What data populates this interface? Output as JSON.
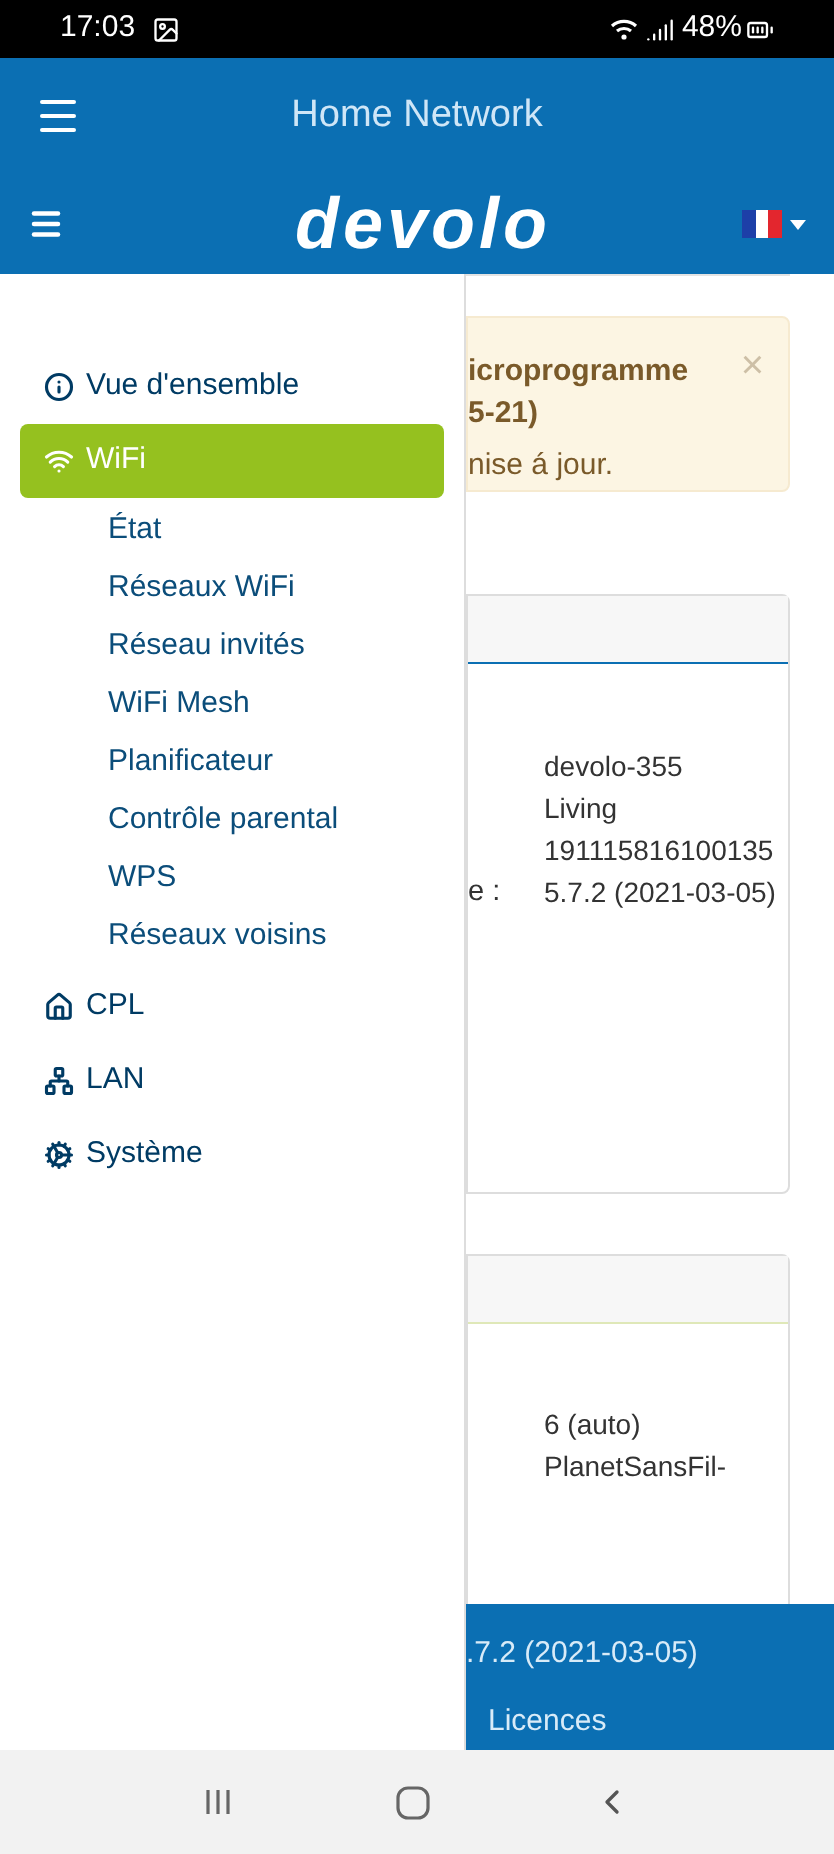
{
  "status_bar": {
    "time": "17:03",
    "battery": "48%"
  },
  "app_bar": {
    "title": "Home Network"
  },
  "header": {
    "logo": "devolo"
  },
  "drawer": {
    "items": [
      {
        "label": "Vue d'ensemble",
        "selected": false
      },
      {
        "label": "WiFi",
        "selected": true,
        "children": [
          {
            "label": "État",
            "selected": false
          },
          {
            "label": "Réseaux WiFi",
            "selected": false
          },
          {
            "label": "Réseau invités",
            "selected": false
          },
          {
            "label": "WiFi Mesh",
            "selected": false
          },
          {
            "label": "Planificateur",
            "selected": false
          },
          {
            "label": "Contrôle parental",
            "selected": false
          },
          {
            "label": "WPS",
            "selected": false
          },
          {
            "label": "Réseaux voisins",
            "selected": false
          }
        ]
      },
      {
        "label": "CPL",
        "selected": false
      },
      {
        "label": "LAN",
        "selected": false
      },
      {
        "label": "Système",
        "selected": false
      }
    ]
  },
  "content": {
    "alert": {
      "title_lines": [
        "icroprogramme",
        "5-21)"
      ],
      "text": "nise á jour.",
      "close": "×"
    },
    "cards": [
      {
        "rows": [
          {
            "value": "devolo-355"
          },
          {
            "value": "Living"
          },
          {
            "value": "191115816100135"
          },
          {
            "label": "e :",
            "value": "5.7.2 (2021-03-05)"
          }
        ]
      },
      {
        "rows": [
          {
            "value": "6 (auto)"
          },
          {
            "value": "PlanetSansFil-"
          }
        ]
      }
    ]
  },
  "footer": {
    "version": ".7.2 (2021-03-05)",
    "link": "Licences"
  }
}
